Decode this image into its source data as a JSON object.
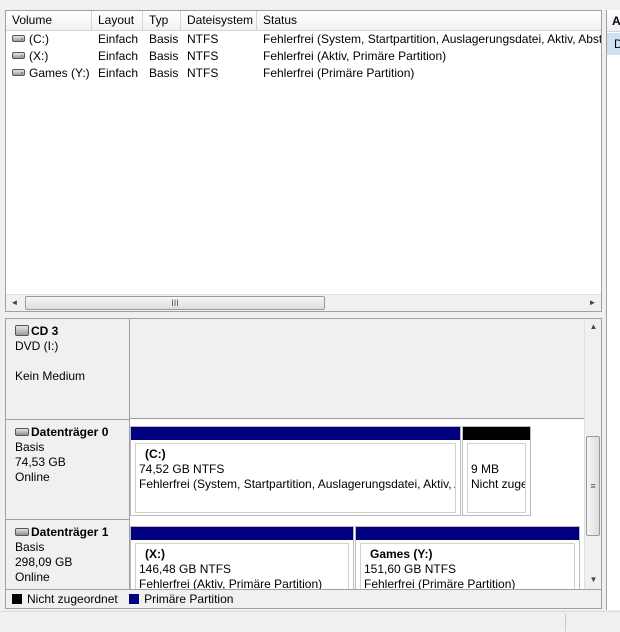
{
  "volume_list": {
    "columns": [
      "Volume",
      "Layout",
      "Typ",
      "Dateisystem",
      "Status"
    ],
    "rows": [
      {
        "volume": "(C:)",
        "layout": "Einfach",
        "typ": "Basis",
        "fs": "NTFS",
        "status": "Fehlerfrei (System, Startpartition, Auslagerungsdatei, Aktiv, Absturzabbild, Primäre Partition)"
      },
      {
        "volume": "(X:)",
        "layout": "Einfach",
        "typ": "Basis",
        "fs": "NTFS",
        "status": "Fehlerfrei (Aktiv, Primäre Partition)"
      },
      {
        "volume": "Games (Y:)",
        "layout": "Einfach",
        "typ": "Basis",
        "fs": "NTFS",
        "status": "Fehlerfrei (Primäre Partition)"
      }
    ]
  },
  "disks": {
    "cd": {
      "title": "CD 3",
      "line1": "DVD (I:)",
      "line3": "Kein Medium"
    },
    "disk0": {
      "title": "Datenträger 0",
      "type": "Basis",
      "size": "74,53 GB",
      "state": "Online",
      "partitions": [
        {
          "name": "(C:)",
          "size": "74,52 GB NTFS",
          "status": "Fehlerfrei (System, Startpartition, Auslagerungsdatei, Aktiv, Absturzabbild)"
        },
        {
          "name": "",
          "size": "9 MB",
          "status": "Nicht zugeordnet"
        }
      ]
    },
    "disk1": {
      "title": "Datenträger 1",
      "type": "Basis",
      "size": "298,09 GB",
      "state": "Online",
      "partitions": [
        {
          "name": "(X:)",
          "size": "146,48 GB NTFS",
          "status": "Fehlerfrei (Aktiv, Primäre Partition)"
        },
        {
          "name": "Games  (Y:)",
          "size": "151,60 GB NTFS",
          "status": "Fehlerfrei (Primäre Partition)"
        }
      ]
    }
  },
  "legend": {
    "items": [
      {
        "label": "Nicht zugeordnet",
        "color": "#000000"
      },
      {
        "label": "Primäre Partition",
        "color": "#000080"
      }
    ]
  },
  "right_pane": {
    "header": "A",
    "item": "D"
  },
  "icons": {
    "hscroll_grip": "III",
    "vscroll_grip": "≡",
    "left_arrow": "◄",
    "right_arrow": "►",
    "up_arrow": "▲",
    "down_arrow": "▼"
  },
  "colors": {
    "primary_partition": "#000080",
    "unallocated": "#000000",
    "selection": "#cfe0f3"
  }
}
